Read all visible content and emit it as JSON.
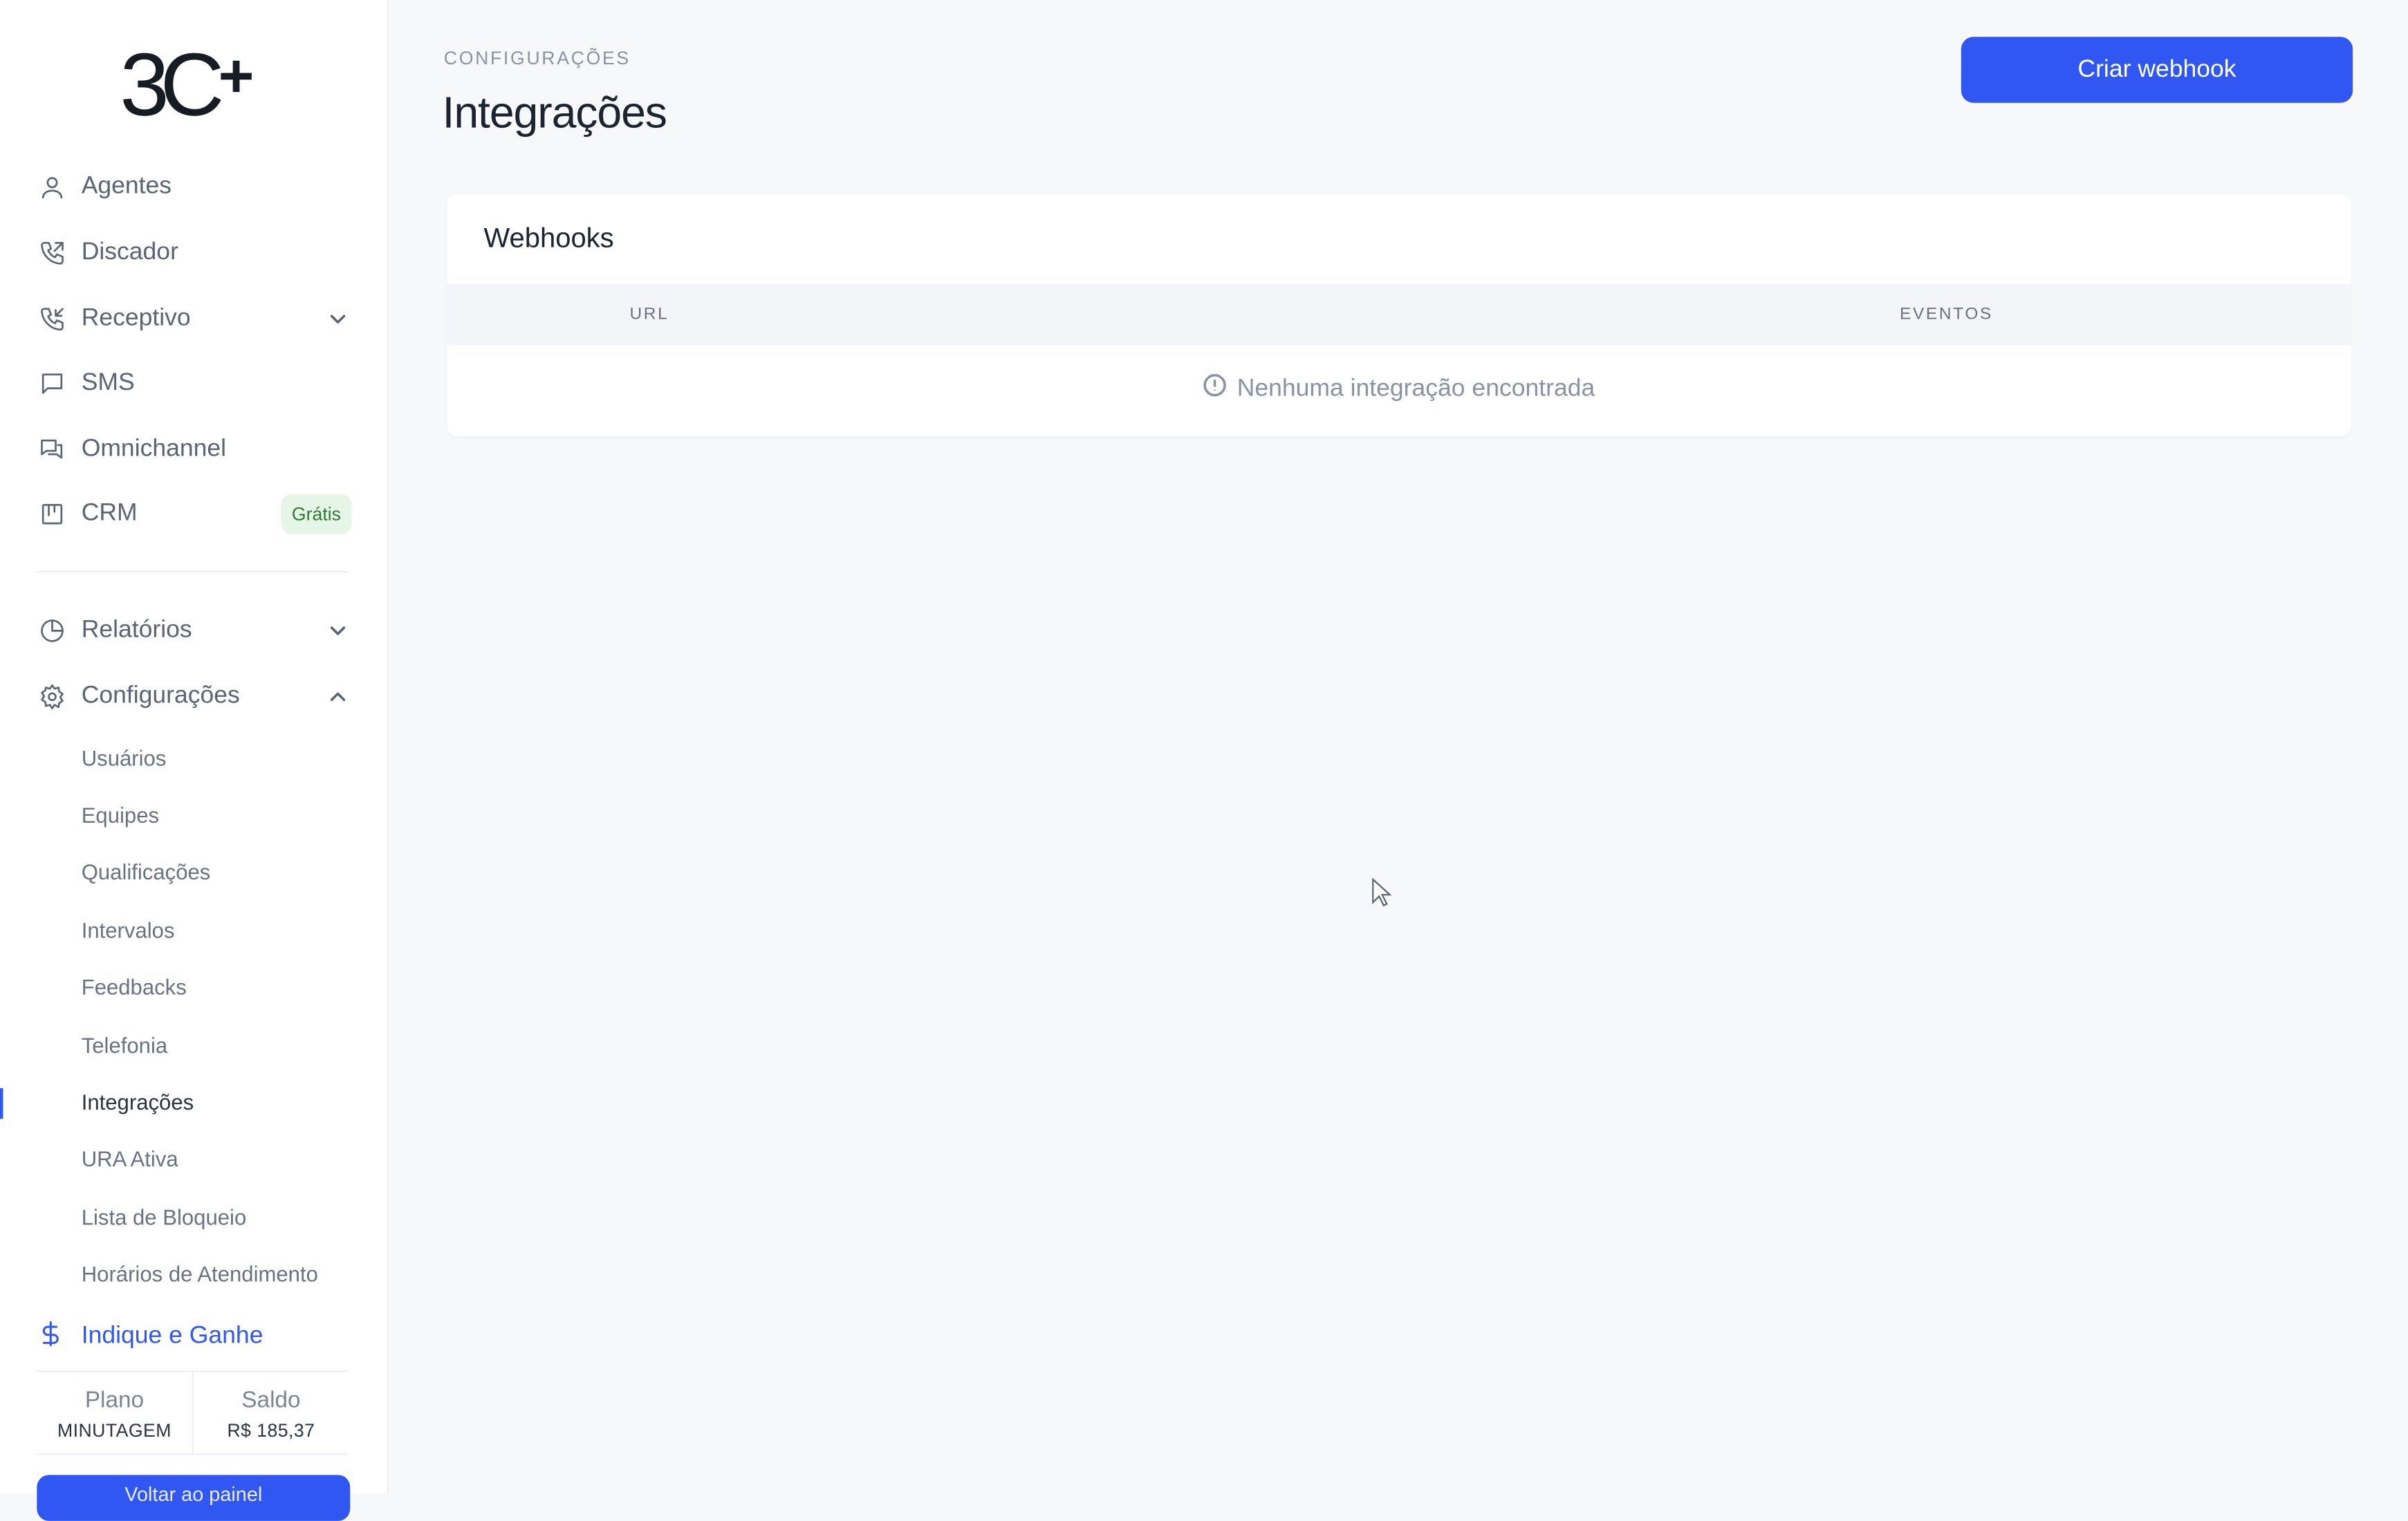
{
  "app": {
    "logo_text": "3C",
    "logo_plus": "+"
  },
  "sidebar": {
    "items": [
      {
        "label": "Agentes",
        "icon": "user-icon"
      },
      {
        "label": "Discador",
        "icon": "phone-outgoing-icon"
      },
      {
        "label": "Receptivo",
        "icon": "phone-incoming-icon",
        "expandable": true
      },
      {
        "label": "SMS",
        "icon": "message-square-icon"
      },
      {
        "label": "Omnichannel",
        "icon": "messages-icon"
      },
      {
        "label": "CRM",
        "icon": "kanban-icon",
        "badge": "Grátis"
      },
      {
        "label": "Relatórios",
        "icon": "pie-chart-icon",
        "expandable": true
      },
      {
        "label": "Configurações",
        "icon": "gear-icon",
        "expandable": true,
        "expanded": true
      }
    ],
    "sub_items": [
      "Usuários",
      "Equipes",
      "Qualificações",
      "Intervalos",
      "Feedbacks",
      "Telefonia",
      "Integrações",
      "URA Ativa",
      "Lista de Bloqueio",
      "Horários de Atendimento"
    ],
    "active_sub_item": "Integrações",
    "indique": {
      "label": "Indique e Ganhe",
      "icon": "dollar-icon"
    },
    "plan": {
      "label": "Plano",
      "value": "MINUTAGEM"
    },
    "balance": {
      "label": "Saldo",
      "value": "R$ 185,37"
    },
    "bottom_button": "Voltar ao painel"
  },
  "main": {
    "breadcrumb": "CONFIGURAÇÕES",
    "title": "Integrações",
    "create_button": "Criar webhook",
    "card": {
      "title": "Webhooks",
      "columns": [
        "URL",
        "EVENTOS"
      ],
      "empty_message": "Nenhuma integração encontrada"
    }
  },
  "colors": {
    "accent": "#3057f2",
    "badge_bg": "#e5f5e6",
    "badge_text": "#2f7a37"
  }
}
